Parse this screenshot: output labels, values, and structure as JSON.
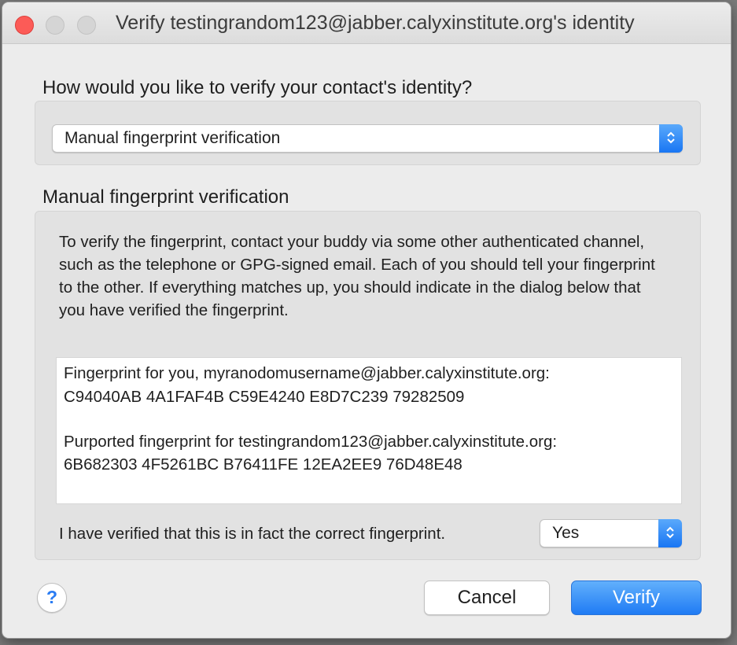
{
  "window": {
    "title": "Verify testingrandom123@jabber.calyxinstitute.org's identity"
  },
  "method_section": {
    "heading": "How would you like to verify your contact's identity?",
    "selected_method": "Manual fingerprint verification"
  },
  "manual_section": {
    "heading": "Manual fingerprint verification",
    "description": "To verify the fingerprint, contact your buddy via some other authenticated channel, such as the telephone or GPG-signed email. Each of you should tell your fingerprint to the other. If everything matches up, you should indicate in the dialog below that you have verified the fingerprint.",
    "own_fingerprint_label": "Fingerprint for you, myranodomusername@jabber.calyxinstitute.org:",
    "own_fingerprint": "C94040AB 4A1FAF4B C59E4240 E8D7C239 79282509",
    "buddy_fingerprint_label": "Purported fingerprint for testingrandom123@jabber.calyxinstitute.org:",
    "buddy_fingerprint": "6B682303 4F5261BC B76411FE 12EA2EE9 76D48E48",
    "confirm_label": "I have verified that this is in fact the correct fingerprint.",
    "confirm_value": "Yes"
  },
  "buttons": {
    "help": "?",
    "cancel": "Cancel",
    "verify": "Verify"
  },
  "colors": {
    "accent": "#1f7bf4",
    "close_button": "#fc5b57"
  }
}
